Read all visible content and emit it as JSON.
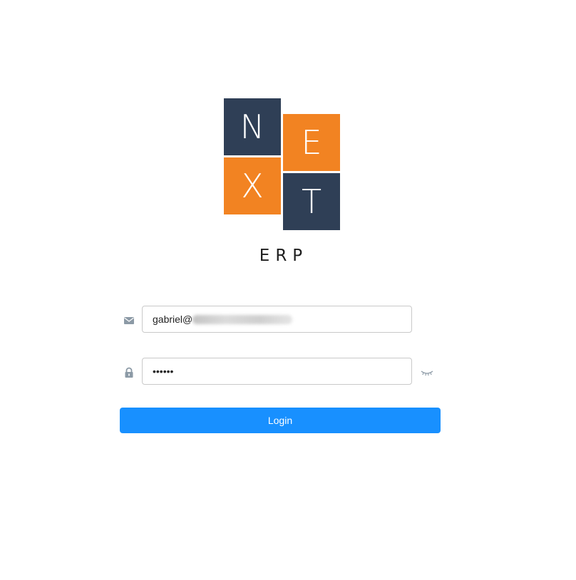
{
  "logo": {
    "letters": [
      "N",
      "E",
      "X",
      "T"
    ],
    "subtitle": "ERP",
    "colors": {
      "navy": "#2f3f56",
      "orange": "#f28322"
    }
  },
  "form": {
    "email": {
      "icon": "envelope-icon",
      "value": "gabriel@"
    },
    "password": {
      "icon": "lock-icon",
      "value": "••••••",
      "visibility_icon": "eye-closed-icon"
    },
    "login": {
      "label": "Login",
      "color": "#1890ff"
    }
  }
}
